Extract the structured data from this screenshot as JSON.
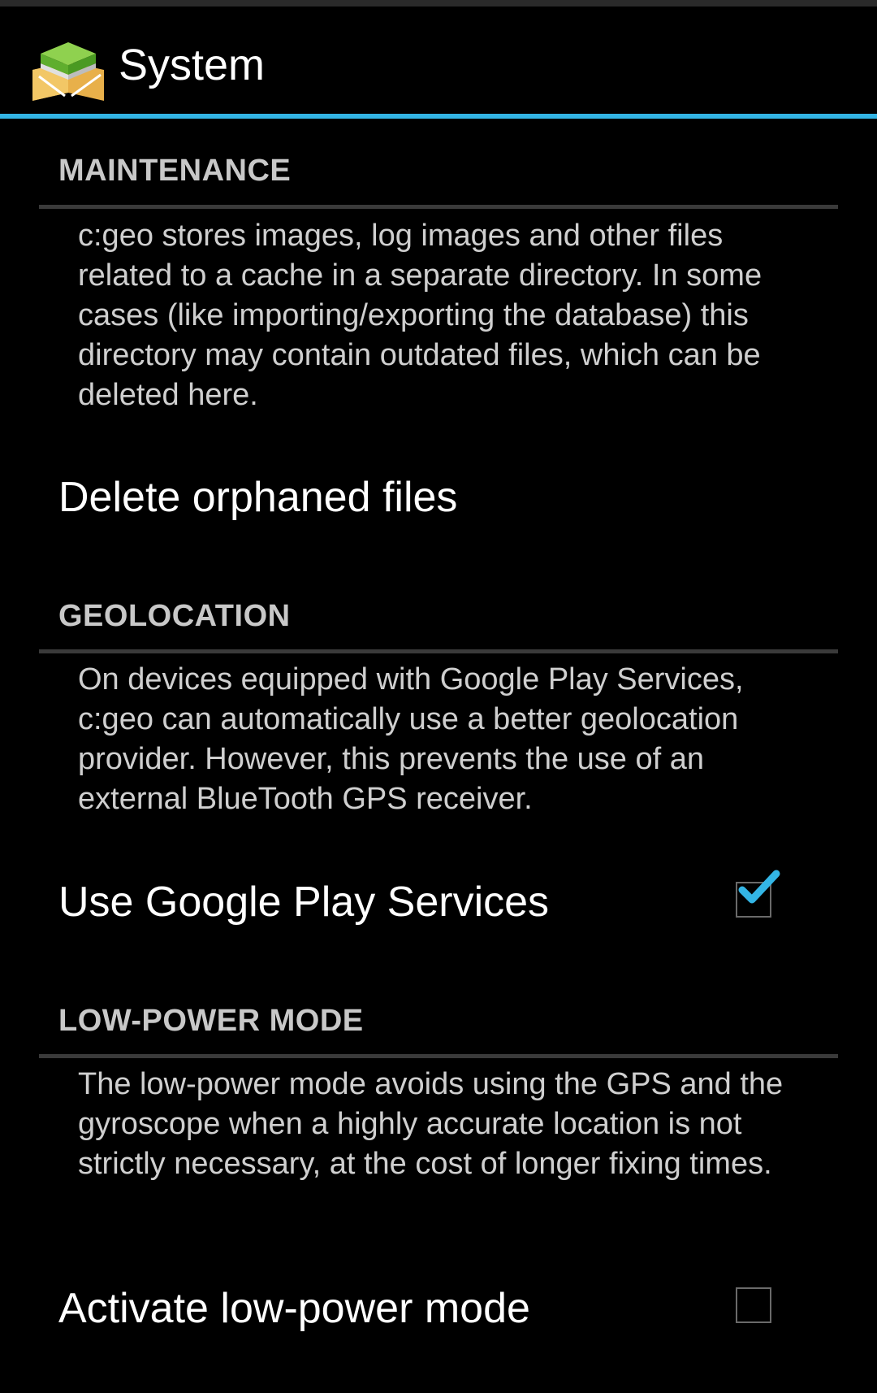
{
  "action_bar": {
    "title": "System",
    "app_icon": "cgeo-app-icon"
  },
  "colors": {
    "accent": "#33b5e5",
    "background": "#000000",
    "header_text": "#c8c8c8",
    "divider": "#3a3a3a"
  },
  "sections": {
    "maintenance": {
      "header": "MAINTENANCE",
      "description": "c:geo stores images, log images and other files related to a cache in a separate directory. In some cases (like importing/exporting the database) this directory may contain outdated files, which can be deleted here.",
      "pref_label": "Delete orphaned files"
    },
    "geolocation": {
      "header": "GEOLOCATION",
      "description": "On devices equipped with Google Play Services, c:geo can automatically use a better geolocation provider. However, this prevents the use of an external BlueTooth GPS receiver.",
      "pref_label": "Use Google Play Services",
      "checked": true,
      "check_icon": "checkmark-icon"
    },
    "low_power": {
      "header": "LOW-POWER MODE",
      "description": "The low-power mode avoids using the GPS and the gyroscope when a highly accurate location is not strictly necessary, at the cost of longer fixing times.",
      "pref_label": "Activate low-power mode",
      "checked": false
    }
  }
}
